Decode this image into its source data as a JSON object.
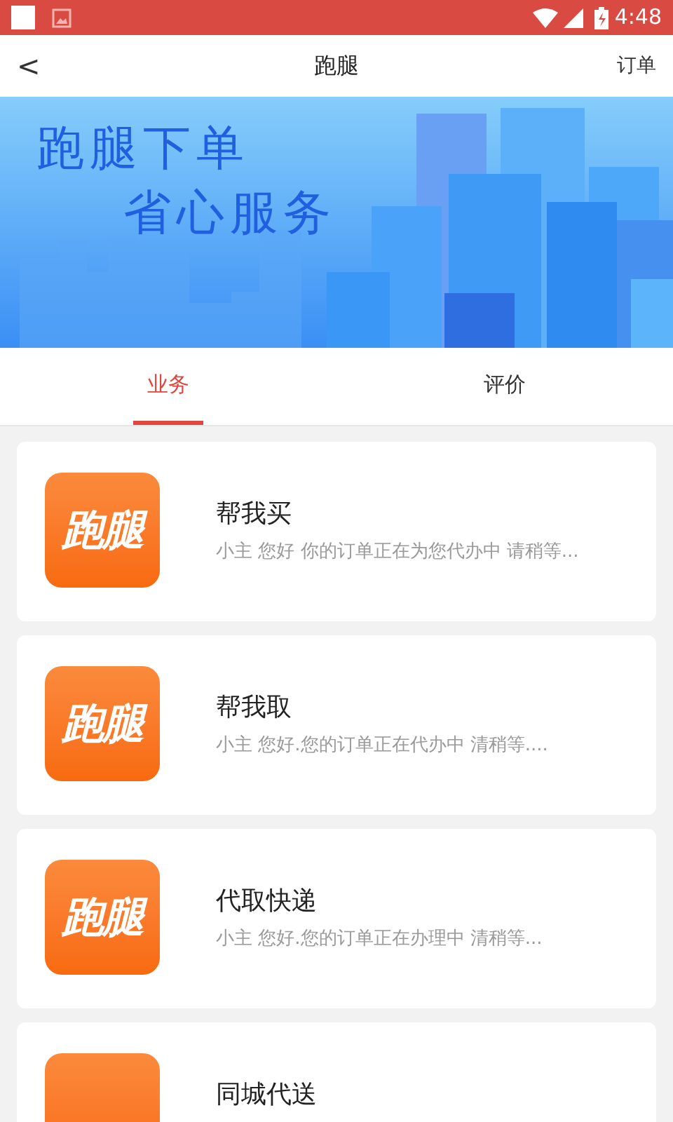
{
  "status_bar": {
    "time": "4:48"
  },
  "header": {
    "back": "<",
    "title": "跑腿",
    "action": "订单"
  },
  "banner": {
    "lines": [
      "跑腿下单",
      "省心服务"
    ]
  },
  "tabs": [
    {
      "label": "业务",
      "selected": true
    },
    {
      "label": "评价",
      "selected": false
    }
  ],
  "services": [
    {
      "logo": "跑腿",
      "title": "帮我买",
      "description": "小主 您好 你的订单正在为您代办中 请稍等..."
    },
    {
      "logo": "跑腿",
      "title": "帮我取",
      "description": "小主 您好.您的订单正在代办中 清稍等...."
    },
    {
      "logo": "跑腿",
      "title": "代取快递",
      "description": "小主 您好.您的订单正在办理中 清稍等..."
    },
    {
      "title": "同城代送"
    }
  ]
}
